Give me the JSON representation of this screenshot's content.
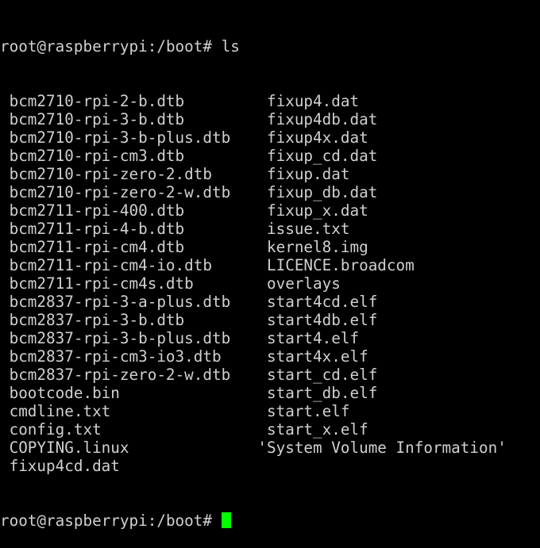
{
  "terminal": {
    "prompt": "root@raspberrypi:/boot# ",
    "command": "ls",
    "cursor_color": "#00ff00",
    "rows": [
      {
        "left": "bcm2710-rpi-2-b.dtb",
        "right": "fixup4.dat"
      },
      {
        "left": "bcm2710-rpi-3-b.dtb",
        "right": "fixup4db.dat"
      },
      {
        "left": "bcm2710-rpi-3-b-plus.dtb",
        "right": "fixup4x.dat"
      },
      {
        "left": "bcm2710-rpi-cm3.dtb",
        "right": "fixup_cd.dat"
      },
      {
        "left": "bcm2710-rpi-zero-2.dtb",
        "right": "fixup.dat"
      },
      {
        "left": "bcm2710-rpi-zero-2-w.dtb",
        "right": "fixup_db.dat"
      },
      {
        "left": "bcm2711-rpi-400.dtb",
        "right": "fixup_x.dat"
      },
      {
        "left": "bcm2711-rpi-4-b.dtb",
        "right": "issue.txt"
      },
      {
        "left": "bcm2711-rpi-cm4.dtb",
        "right": "kernel8.img"
      },
      {
        "left": "bcm2711-rpi-cm4-io.dtb",
        "right": "LICENCE.broadcom"
      },
      {
        "left": "bcm2711-rpi-cm4s.dtb",
        "right": "overlays"
      },
      {
        "left": "bcm2837-rpi-3-a-plus.dtb",
        "right": "start4cd.elf"
      },
      {
        "left": "bcm2837-rpi-3-b.dtb",
        "right": "start4db.elf"
      },
      {
        "left": "bcm2837-rpi-3-b-plus.dtb",
        "right": "start4.elf"
      },
      {
        "left": "bcm2837-rpi-cm3-io3.dtb",
        "right": "start4x.elf"
      },
      {
        "left": "bcm2837-rpi-zero-2-w.dtb",
        "right": "start_cd.elf"
      },
      {
        "left": "bootcode.bin",
        "right": "start_db.elf"
      },
      {
        "left": "cmdline.txt",
        "right": "start.elf"
      },
      {
        "left": "config.txt",
        "right": "start_x.elf"
      },
      {
        "left": "COPYING.linux",
        "right": "'System Volume Information'"
      },
      {
        "left": "fixup4cd.dat",
        "right": ""
      }
    ]
  }
}
